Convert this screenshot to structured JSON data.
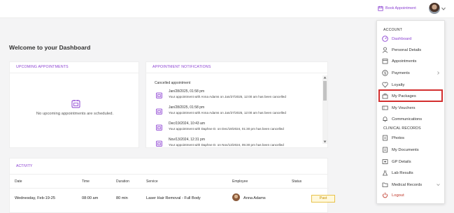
{
  "topbar": {
    "book_label": "Book Appointment"
  },
  "page": {
    "title": "Welcome to your Dashboard"
  },
  "upcoming": {
    "heading": "UPCOMING APPOINTMENTS",
    "empty_text": "No upcoming appointments are scheduled."
  },
  "notifications": {
    "heading": "APPOINTMENT NOTIFICATIONS",
    "subheading": "Cancelled appointment",
    "items": [
      {
        "date": "Jan/28/2025, 01:58 pm",
        "message": "Your appointment with Anna Adams on Jan/27/2025, 12:00 am has been cancelled"
      },
      {
        "date": "Jan/28/2025, 01:58 pm",
        "message": "Your appointment with Anna Adams on Jan/27/2025, 12:00 am has been cancelled"
      },
      {
        "date": "Dec/19/2024, 10:43 am",
        "message": "Your appointment with Daphne D. on Dec/19/2024, 01:30 pm has been cancelled"
      },
      {
        "date": "Nov/13/2024, 12:31 pm",
        "message": "Your appointment with Daphne D. on Nov/13/2024, 05:30 pm has been cancelled"
      }
    ]
  },
  "activity": {
    "heading": "ACTIVITY",
    "columns": [
      "Date",
      "Time",
      "Duration",
      "Service",
      "Employee",
      "Status"
    ],
    "rows": [
      {
        "date": "Wednesday, Feb-19-25",
        "time": "08:00 am",
        "duration": "80 min",
        "service": "Laser Hair Removal - Full Body",
        "employee": "Anna Adams",
        "status": "Past"
      }
    ]
  },
  "menu": {
    "account_label": "ACCOUNT",
    "clinical_label": "CLINICAL RECORDS",
    "items": [
      {
        "label": "Dashboard",
        "icon": "dashboard-icon"
      },
      {
        "label": "Personal Details",
        "icon": "user-icon"
      },
      {
        "label": "Appointments",
        "icon": "calendar-icon"
      },
      {
        "label": "Payments",
        "icon": "dollar-icon"
      },
      {
        "label": "Loyalty",
        "icon": "heart-icon"
      },
      {
        "label": "My Packages",
        "icon": "package-icon"
      },
      {
        "label": "My Vouchers",
        "icon": "voucher-icon"
      },
      {
        "label": "Communications",
        "icon": "bell-icon"
      }
    ],
    "clinical_items": [
      {
        "label": "Photos",
        "icon": "photo-icon"
      },
      {
        "label": "My Documents",
        "icon": "document-icon"
      },
      {
        "label": "GP Details",
        "icon": "doctor-icon"
      },
      {
        "label": "Lab Results",
        "icon": "flask-icon"
      },
      {
        "label": "Medical Records",
        "icon": "folder-icon"
      },
      {
        "label": "Logout",
        "icon": "power-icon"
      }
    ]
  },
  "colors": {
    "accent": "#8a3fd1",
    "logout": "#c0392b",
    "highlight": "#d32f2f",
    "status_past": "#e8c24a"
  }
}
